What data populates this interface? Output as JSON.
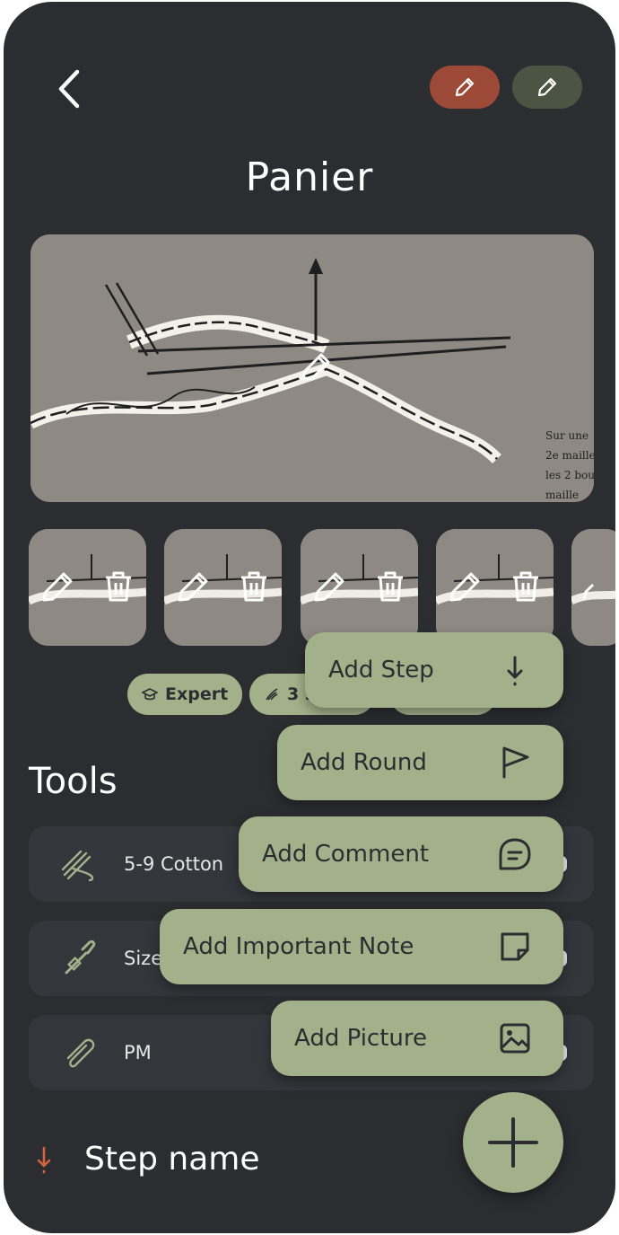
{
  "header": {
    "title": "Panier",
    "edit_red_icon": "pencil-icon",
    "edit_green_icon": "pencil-icon"
  },
  "chips": [
    {
      "icon": "graduation-cap-icon",
      "label": "Expert"
    },
    {
      "icon": "yarn-icon",
      "label": "3 s"
    }
  ],
  "tools": {
    "heading": "Tools",
    "items": [
      {
        "icon": "yarn-skein-icon",
        "label": "5-9 Cotton"
      },
      {
        "icon": "crochet-hook-icon",
        "label": "Size"
      },
      {
        "icon": "paperclip-icon",
        "label": "PM"
      }
    ]
  },
  "step": {
    "icon": "arrow-down-icon",
    "label": "Step name"
  },
  "menu": [
    {
      "label": "Add Step",
      "icon": "arrow-down-icon"
    },
    {
      "label": "Add Round",
      "icon": "flag-icon"
    },
    {
      "label": "Add Comment",
      "icon": "comment-icon"
    },
    {
      "label": "Add Important Note",
      "icon": "sticky-note-icon"
    },
    {
      "label": "Add Picture",
      "icon": "image-icon"
    }
  ],
  "fab": {
    "icon": "plus-icon"
  },
  "colors": {
    "background": "#2b2d31",
    "accent_green": "#a3b18a",
    "accent_red": "#9c4a37",
    "dark_green": "#4c5443"
  }
}
